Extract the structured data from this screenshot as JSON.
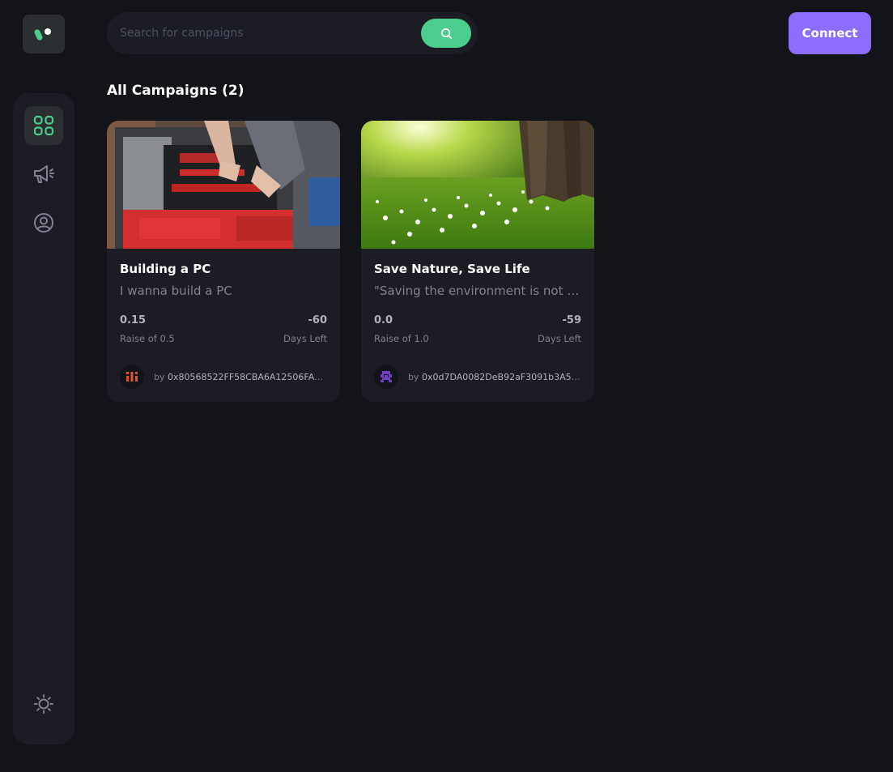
{
  "header": {
    "search_placeholder": "Search for campaigns",
    "connect_label": "Connect"
  },
  "sidebar": {
    "items": [
      {
        "icon": "dashboard-icon",
        "active": true
      },
      {
        "icon": "campaign-icon",
        "active": false
      },
      {
        "icon": "profile-icon",
        "active": false
      }
    ],
    "theme_icon": "sun-icon"
  },
  "main": {
    "heading": "All Campaigns (2)",
    "campaigns": [
      {
        "title": "Building a PC",
        "description": "I wanna build a PC",
        "amount_collected": "0.15",
        "target_label": "Raise of 0.5",
        "days_left": "-60",
        "days_label": "Days Left",
        "owner_prefix": "by",
        "owner": "0x80568522FF58CBA6A12506FA2..."
      },
      {
        "title": "Save Nature, Save Life",
        "description": "\"Saving the environment is not a choice, it's a responsibility\"",
        "amount_collected": "0.0",
        "target_label": "Raise of 1.0",
        "days_left": "-59",
        "days_label": "Days Left",
        "owner_prefix": "by",
        "owner": "0x0d7DA0082DeB92aF3091b3A50..."
      }
    ]
  },
  "colors": {
    "background": "#13131a",
    "panel": "#1c1c24",
    "accent_green": "#4acd8d",
    "accent_purple": "#8c6dfd"
  }
}
